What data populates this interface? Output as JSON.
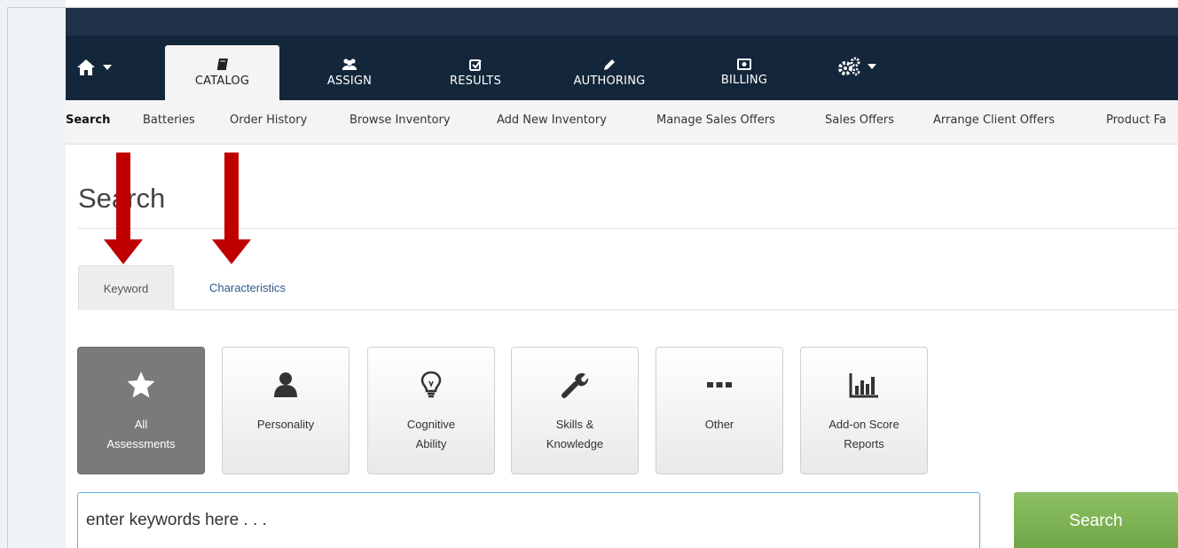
{
  "nav": {
    "home_icon": "home-icon",
    "tabs": [
      {
        "label": "CATALOG",
        "icon": "book-icon",
        "active": true
      },
      {
        "label": "ASSIGN",
        "icon": "users-icon",
        "active": false
      },
      {
        "label": "RESULTS",
        "icon": "check-square-icon",
        "active": false
      },
      {
        "label": "AUTHORING",
        "icon": "pencil-icon",
        "active": false
      },
      {
        "label": "BILLING",
        "icon": "money-icon",
        "active": false
      }
    ],
    "settings_icon": "gears-icon"
  },
  "subnav": {
    "items": [
      {
        "label": "Search",
        "active": true
      },
      {
        "label": "Batteries"
      },
      {
        "label": "Order History"
      },
      {
        "label": "Browse Inventory"
      },
      {
        "label": "Add New Inventory"
      },
      {
        "label": "Manage Sales Offers"
      },
      {
        "label": "Sales Offers"
      },
      {
        "label": "Arrange Client Offers"
      },
      {
        "label": "Product Fa"
      }
    ]
  },
  "page": {
    "title": "Search"
  },
  "tabs": {
    "keyword": "Keyword",
    "characteristics": "Characteristics"
  },
  "categories": [
    {
      "line1": "All",
      "line2": "Assessments",
      "icon": "star-icon",
      "active": true
    },
    {
      "line1": "Personality",
      "line2": "",
      "icon": "user-icon",
      "active": false
    },
    {
      "line1": "Cognitive",
      "line2": "Ability",
      "icon": "lightbulb-icon",
      "active": false
    },
    {
      "line1": "Skills &",
      "line2": "Knowledge",
      "icon": "wrench-icon",
      "active": false
    },
    {
      "line1": "Other",
      "line2": "",
      "icon": "ellipsis-icon",
      "active": false
    },
    {
      "line1": "Add-on Score",
      "line2": "Reports",
      "icon": "bar-chart-icon",
      "active": false
    }
  ],
  "search": {
    "placeholder": "enter keywords here . . .",
    "button_label": "Search"
  },
  "colors": {
    "header": "#14263a",
    "header_top": "#1f3249",
    "subnav_bg": "#f4f4f4",
    "active_tile": "#7a7a7a",
    "search_button": "#7ab355",
    "annotation_arrow": "#c00000",
    "link": "#2a5a8a"
  }
}
